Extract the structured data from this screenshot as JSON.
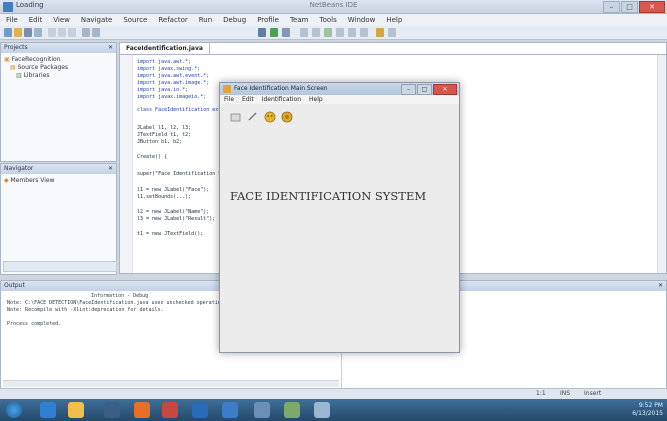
{
  "ide": {
    "title": "NetBeans IDE",
    "app_label": "Loading",
    "menu": [
      "File",
      "Edit",
      "View",
      "Navigate",
      "Source",
      "Refactor",
      "Run",
      "Debug",
      "Profile",
      "Team",
      "Tools",
      "Window",
      "Help"
    ],
    "projects_panel": {
      "title": "Projects",
      "items": [
        "FaceRecognition",
        "Source Packages",
        "Libraries"
      ]
    },
    "navigator_panel": {
      "title": "Navigator",
      "items": [
        "Members View"
      ]
    },
    "editor_tab": "FaceIdentification.java",
    "code_lines": [
      "import java.awt.*;",
      "import javax.swing.*;",
      "import java.awt.event.*;",
      "import java.awt.image.*;",
      "import java.io.*;",
      "import javax.imageio.*;",
      "",
      "class FaceIdentification extends JFrame {",
      "",
      "JLabel l1, l2, l3;",
      "JTextField t1, t2;",
      "JButton b1, b2;",
      "",
      "Create() {",
      "",
      "super(\"Face Identification System\");",
      "",
      "l1 = new JLabel(\"Face\");",
      "l1.setBounds(...);",
      "",
      "l2 = new JLabel(\"Name\");",
      "l3 = new JLabel(\"Result\");",
      "",
      "t1 = new JTextField();"
    ],
    "output": {
      "title": "Output",
      "lines": [
        "Note: C:\\FACE DETECTION\\FaceIdentification.java uses unchecked operations.",
        "Note: Recompile with -Xlint:deprecation for details.",
        "",
        "Process completed."
      ],
      "header": "Information - Debug"
    },
    "status": [
      "INS",
      "1:1",
      "Insert"
    ],
    "taskbar_clock": {
      "time": "9:52 PM",
      "date": "6/13/2015"
    }
  },
  "face_window": {
    "title": "Face Identification Main Screen",
    "menu": [
      "File",
      "Edit",
      "Identification",
      "Help"
    ],
    "heading": "FACE IDENTIFICATION SYSTEM",
    "tool_buttons": [
      "open-icon",
      "edit-icon",
      "face-icon",
      "identify-icon"
    ]
  },
  "colors": {
    "accent": "#3c7fc4",
    "close": "#d6584e",
    "taskbar": "#24496b"
  }
}
